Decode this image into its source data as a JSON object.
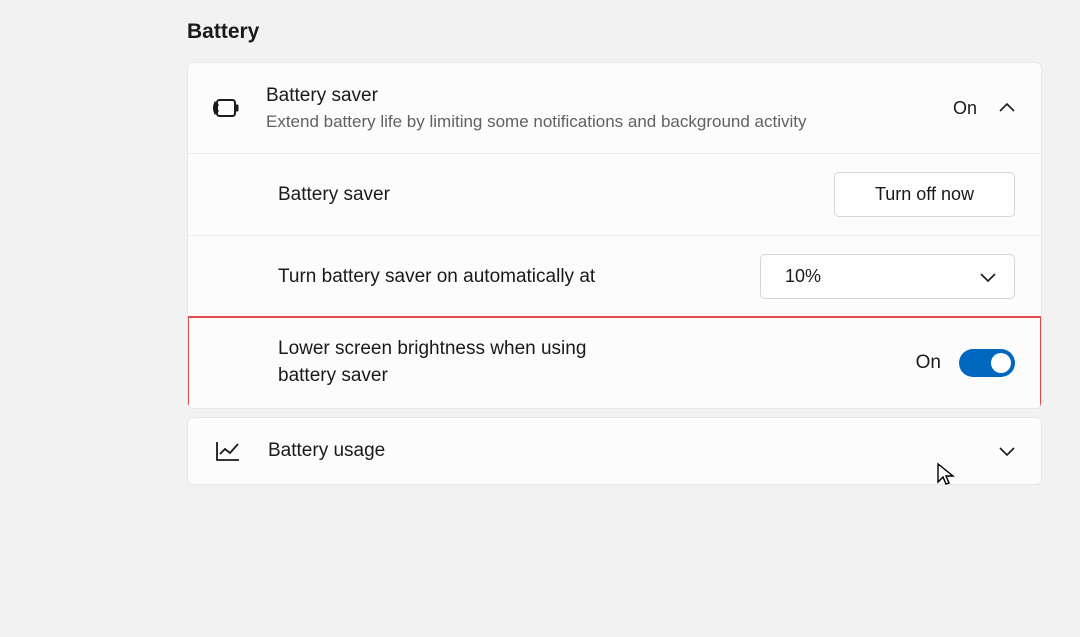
{
  "section": {
    "title": "Battery"
  },
  "batterySaver": {
    "title": "Battery saver",
    "description": "Extend battery life by limiting some notifications and background activity",
    "status": "On",
    "rows": {
      "manual": {
        "label": "Battery saver",
        "button": "Turn off now"
      },
      "auto": {
        "label": "Turn battery saver on automatically at",
        "value": "10%"
      },
      "brightness": {
        "label": "Lower screen brightness when using battery saver",
        "state": "On"
      }
    }
  },
  "batteryUsage": {
    "label": "Battery usage"
  }
}
